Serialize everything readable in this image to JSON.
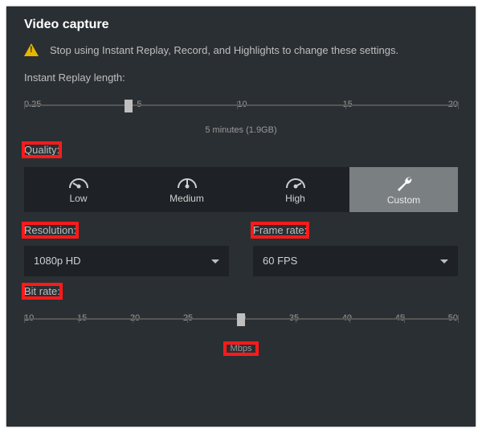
{
  "title": "Video capture",
  "warning": "Stop using Instant Replay, Record, and Highlights to change these settings.",
  "replay": {
    "label": "Instant Replay length:",
    "ticks": [
      "0.25",
      "5",
      "10",
      "15",
      "20"
    ],
    "thumb_pct": 24,
    "caption": "5 minutes (1.9GB)"
  },
  "quality": {
    "label": "Quality:",
    "options": [
      {
        "key": "low",
        "label": "Low"
      },
      {
        "key": "medium",
        "label": "Medium"
      },
      {
        "key": "high",
        "label": "High"
      },
      {
        "key": "custom",
        "label": "Custom"
      }
    ],
    "selected": "custom"
  },
  "resolution": {
    "label": "Resolution:",
    "value": "1080p HD"
  },
  "framerate": {
    "label": "Frame rate:",
    "value": "60 FPS"
  },
  "bitrate": {
    "label": "Bit rate:",
    "ticks": [
      "10",
      "15",
      "20",
      "25",
      "30",
      "35",
      "40",
      "45",
      "50"
    ],
    "thumb_pct": 50,
    "unit": "Mbps"
  }
}
